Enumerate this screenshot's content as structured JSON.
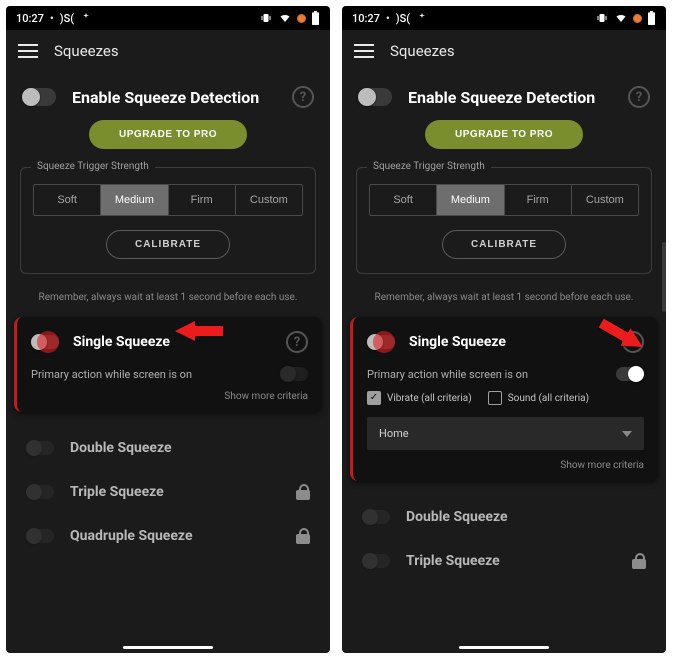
{
  "statusbar": {
    "time": "10:27",
    "left_extra": ")S("
  },
  "appbar": {
    "title": "Squeezes"
  },
  "enable": {
    "label": "Enable Squeeze Detection"
  },
  "upgrade": {
    "label": "UPGRADE TO PRO"
  },
  "strength": {
    "legend": "Squeeze Trigger Strength",
    "options": [
      "Soft",
      "Medium",
      "Firm",
      "Custom"
    ],
    "selected_index": 1,
    "calibrate": "CALIBRATE"
  },
  "hint": "Remember, always wait at least 1 second before each use.",
  "single_card": {
    "title": "Single Squeeze",
    "subtitle": "Primary action while screen is on",
    "vibrate_label": "Vibrate (all criteria)",
    "sound_label": "Sound (all criteria)",
    "action_selected": "Home",
    "more": "Show more criteria"
  },
  "list": {
    "double": "Double Squeeze",
    "triple": "Triple Squeeze",
    "quadruple": "Quadruple Squeeze"
  }
}
